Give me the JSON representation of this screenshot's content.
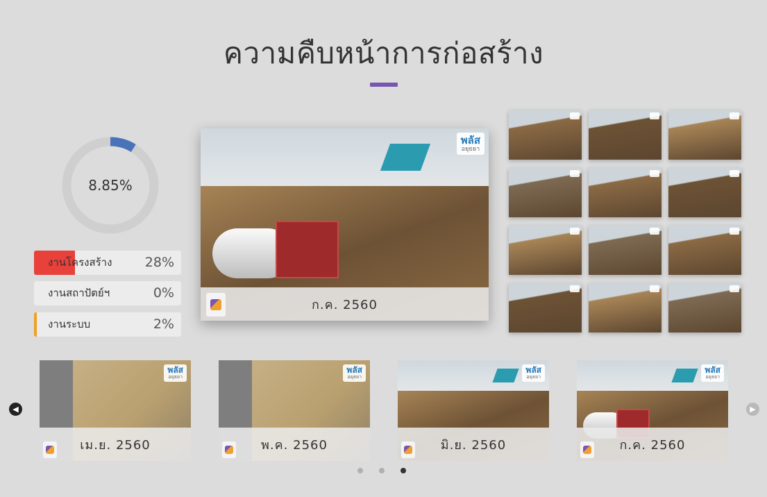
{
  "header": {
    "title": "ความคืบหน้าการก่อสร้าง"
  },
  "progress": {
    "overall_label": "8.85%",
    "overall_fraction": 0.0885,
    "ring_color": "#4a72b8",
    "track_color": "#cfcfcf"
  },
  "stats": [
    {
      "label": "งานโครงสร้าง",
      "value": "28%",
      "fraction": 0.28,
      "color": "#e8403a"
    },
    {
      "label": "งานสถาปัตย์ฯ",
      "value": "0%",
      "fraction": 0.0,
      "color": "#7a55b0"
    },
    {
      "label": "งานระบบ",
      "value": "2%",
      "fraction": 0.02,
      "color": "#f0a020"
    }
  ],
  "main_photo": {
    "caption": "ก.ค. 2560",
    "brand_badge": "พลัส",
    "brand_badge_sub": "อยุธยา"
  },
  "gallery": {
    "thumbnail_count": 12
  },
  "timeline": {
    "cards": [
      {
        "caption": "เม.ย. 2560",
        "brand_badge": "พลัส",
        "brand_badge_sub": "อยุธยา"
      },
      {
        "caption": "พ.ค. 2560",
        "brand_badge": "พลัส",
        "brand_badge_sub": "อยุธยา"
      },
      {
        "caption": "มิ.ย. 2560",
        "brand_badge": "พลัส",
        "brand_badge_sub": "อยุธยา"
      },
      {
        "caption": "ก.ค. 2560",
        "brand_badge": "พลัส",
        "brand_badge_sub": "อยุธยา"
      }
    ],
    "prev_icon": "chevron-left-icon",
    "next_icon": "chevron-right-icon"
  },
  "pagination": {
    "page_count": 3,
    "active_index": 2
  },
  "accent_color": "#7a55b0"
}
